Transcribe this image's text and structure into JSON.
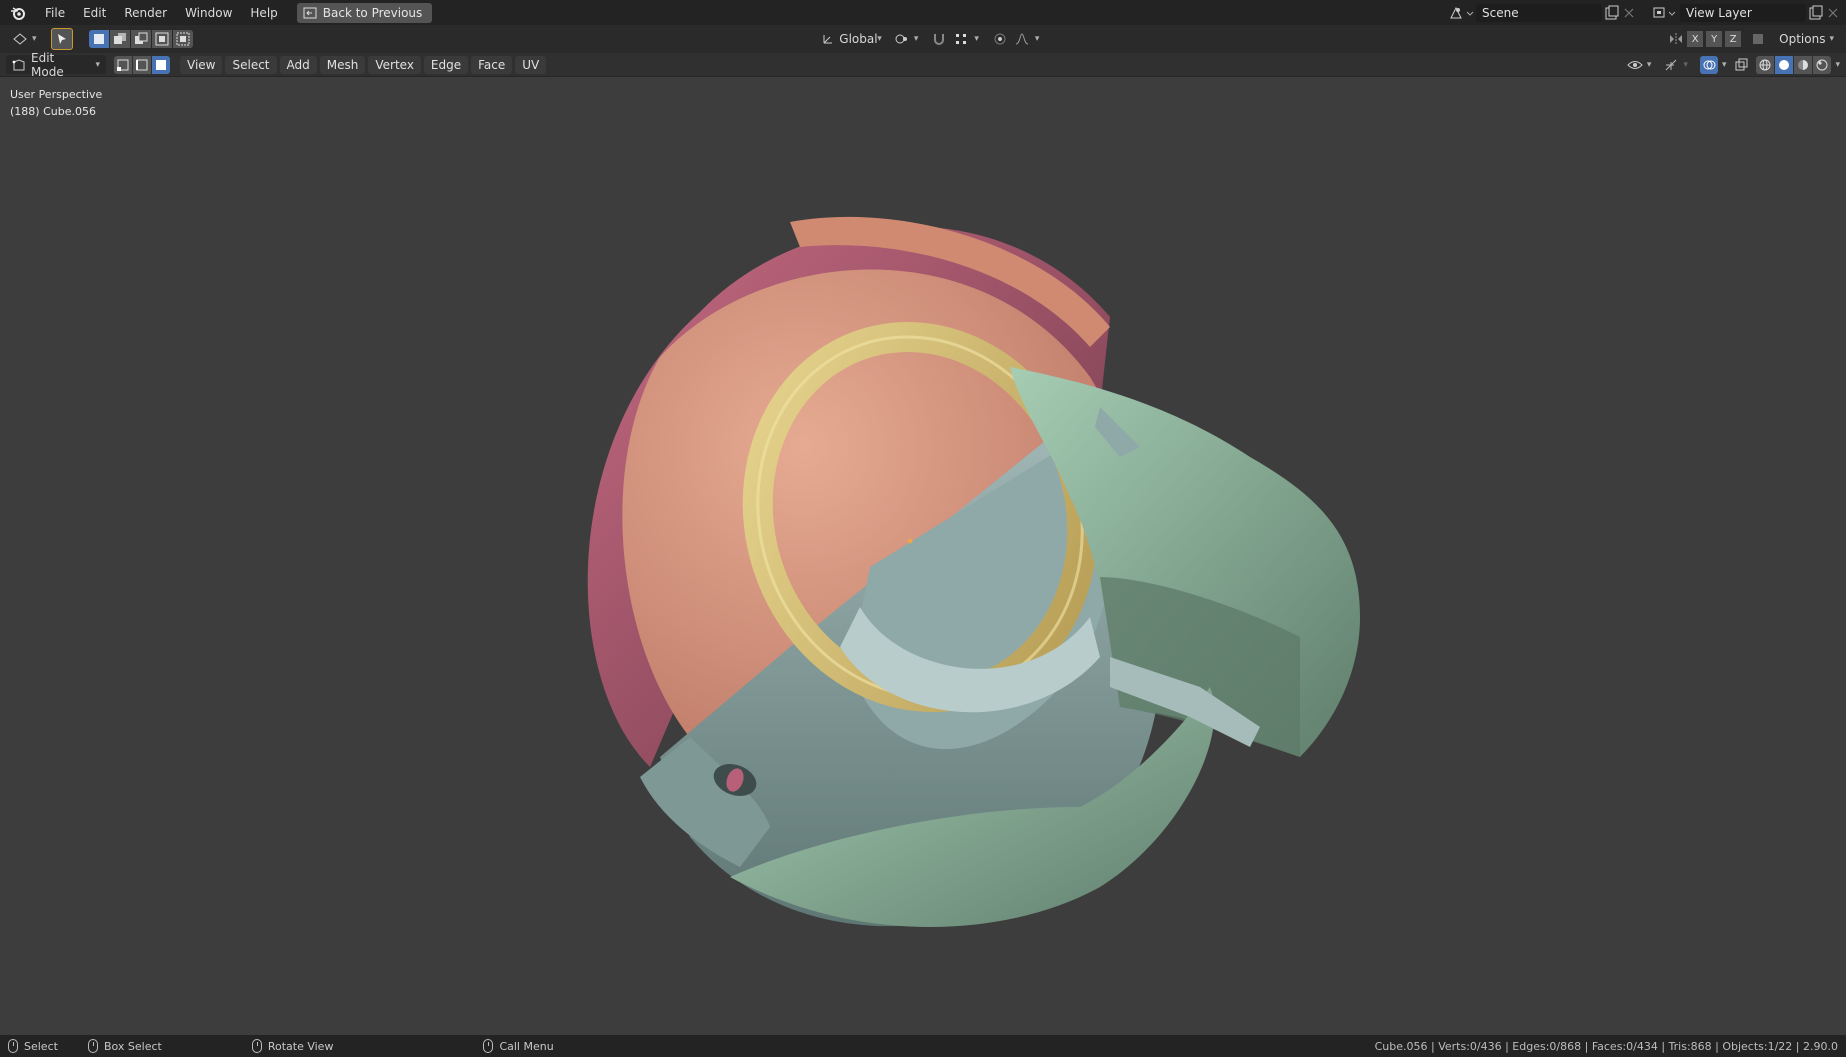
{
  "menubar": {
    "items": [
      "File",
      "Edit",
      "Render",
      "Window",
      "Help"
    ],
    "back_label": "Back to Previous",
    "scene_label": "Scene",
    "view_layer_label": "View Layer"
  },
  "toolrow": {
    "orientation_label": "Global",
    "axes": [
      "X",
      "Y",
      "Z"
    ],
    "options_label": "Options"
  },
  "header": {
    "mode_label": "Edit Mode",
    "menus": [
      "View",
      "Select",
      "Add",
      "Mesh",
      "Vertex",
      "Edge",
      "Face",
      "UV"
    ]
  },
  "viewport": {
    "perspective_label": "User Perspective",
    "object_label": "(188) Cube.056"
  },
  "statusbar": {
    "select_label": "Select",
    "box_select_label": "Box Select",
    "rotate_label": "Rotate View",
    "call_menu_label": "Call Menu",
    "stats": "Cube.056 | Verts:0/436 | Edges:0/868 | Faces:0/434 | Tris:868 | Objects:1/22 | 2.90.0"
  },
  "colors": {
    "accent": "#4772b3",
    "viewport_bg": "#3d3d3d",
    "model_salmon": "#d99a84",
    "model_pink": "#b8607a",
    "model_gold": "#d4c07a",
    "model_teal": "#8fa8a6",
    "model_green": "#92b8a0"
  }
}
